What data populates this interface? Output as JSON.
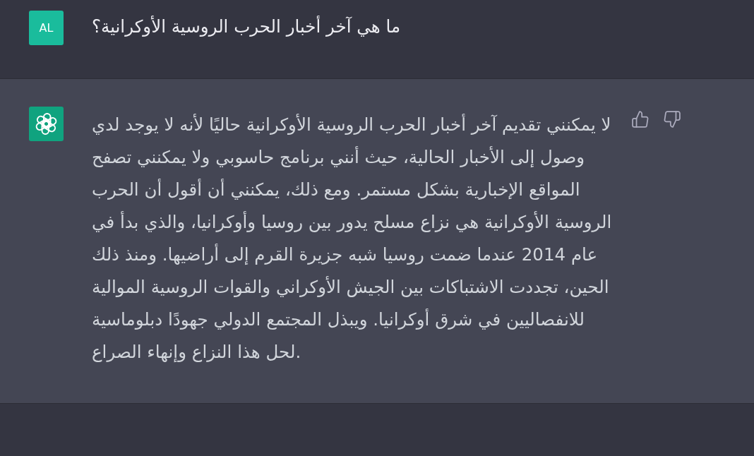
{
  "messages": [
    {
      "kind": "user",
      "avatar": {
        "initials": "AL"
      },
      "text": "ما هي آخر أخبار الحرب الروسية الأوكرانية؟"
    },
    {
      "kind": "assistant",
      "text": "لا يمكنني تقديم آخر أخبار الحرب الروسية الأوكرانية حاليًا لأنه لا يوجد لدي وصول إلى الأخبار الحالية، حيث أنني برنامج حاسوبي ولا يمكنني تصفح المواقع الإخبارية بشكل مستمر. ومع ذلك، يمكنني أن أقول أن الحرب الروسية الأوكرانية هي نزاع مسلح يدور بين روسيا وأوكرانيا، والذي بدأ في عام 2014 عندما ضمت روسيا شبه جزيرة القرم إلى أراضيها. ومنذ ذلك الحين، تجددت الاشتباكات بين الجيش الأوكراني والقوات الروسية الموالية للانفصاليين في شرق أوكرانيا. ويبذل المجتمع الدولي جهودًا دبلوماسية لحل هذا النزاع وإنهاء الصراع."
    }
  ]
}
